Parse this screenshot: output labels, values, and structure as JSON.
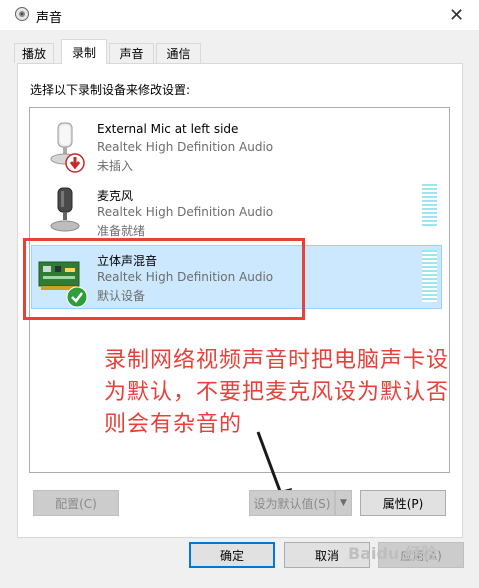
{
  "window": {
    "title": "声音",
    "close_glyph": "✕"
  },
  "tabs": [
    {
      "label": "播放",
      "active": false
    },
    {
      "label": "录制",
      "active": true
    },
    {
      "label": "声音",
      "active": false
    },
    {
      "label": "通信",
      "active": false
    }
  ],
  "instruction": "选择以下录制设备来修改设置:",
  "devices": [
    {
      "name": "External Mic at left side",
      "driver": "Realtek High Definition Audio",
      "status": "未插入",
      "icon": "microphone-icon",
      "badge": "unplugged-badge-icon"
    },
    {
      "name": "麦克风",
      "driver": "Realtek High Definition Audio",
      "status": "准备就绪",
      "icon": "microphone-icon"
    },
    {
      "name": "立体声混音",
      "driver": "Realtek High Definition Audio",
      "status": "默认设备",
      "icon": "sound-card-icon",
      "badge": "default-check-icon",
      "selected": true
    }
  ],
  "annotation": "录制网络视频声音时把电脑声卡设为默认，不要把麦克风设为默认否则会有杂音的",
  "buttons": {
    "configure": "配置(C)",
    "set_default": "设为默认值(S)",
    "properties": "属性(P)",
    "ok": "确定",
    "cancel": "取消",
    "apply": "应用(A)"
  },
  "watermark": "Baidu 经验",
  "colors": {
    "highlight": "#cce8ff",
    "annotation_red": "#e8413a",
    "level_meter": "#9ee5ef"
  }
}
